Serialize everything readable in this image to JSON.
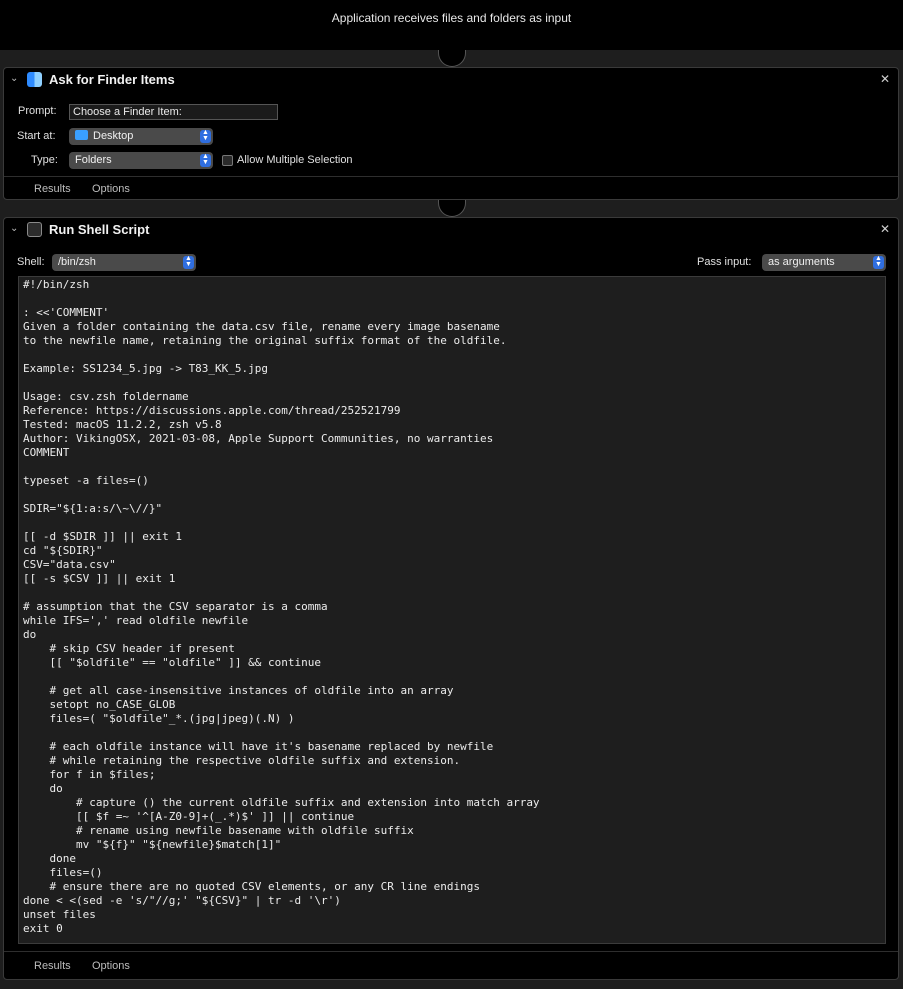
{
  "workflow": {
    "header_text": "Application receives files and folders as input"
  },
  "ask_finder": {
    "title": "Ask for Finder Items",
    "prompt_label": "Prompt:",
    "prompt_value": "Choose a Finder Item:",
    "start_label": "Start at:",
    "start_value": "Desktop",
    "type_label": "Type:",
    "type_value": "Folders",
    "allow_multiple_label": "Allow Multiple Selection",
    "allow_multiple_checked": false,
    "tabs": [
      "Results",
      "Options"
    ]
  },
  "shell_action": {
    "title": "Run Shell Script",
    "shell_label": "Shell:",
    "shell_value": "/bin/zsh",
    "pass_input_label": "Pass input:",
    "pass_input_value": "as arguments",
    "script": "#!/bin/zsh\n\n: <<'COMMENT'\nGiven a folder containing the data.csv file, rename every image basename\nto the newfile name, retaining the original suffix format of the oldfile.\n\nExample: SS1234_5.jpg -> T83_KK_5.jpg\n\nUsage: csv.zsh foldername\nReference: https://discussions.apple.com/thread/252521799\nTested: macOS 11.2.2, zsh v5.8\nAuthor: VikingOSX, 2021-03-08, Apple Support Communities, no warranties\nCOMMENT\n\ntypeset -a files=()\n\nSDIR=\"${1:a:s/\\~\\//}\"\n\n[[ -d $SDIR ]] || exit 1\ncd \"${SDIR}\"\nCSV=\"data.csv\"\n[[ -s $CSV ]] || exit 1\n\n# assumption that the CSV separator is a comma\nwhile IFS=',' read oldfile newfile\ndo\n    # skip CSV header if present\n    [[ \"$oldfile\" == \"oldfile\" ]] && continue\n\n    # get all case-insensitive instances of oldfile into an array\n    setopt no_CASE_GLOB\n    files=( \"$oldfile\"_*.(jpg|jpeg)(.N) )\n\n    # each oldfile instance will have it's basename replaced by newfile\n    # while retaining the respective oldfile suffix and extension.\n    for f in $files;\n    do\n        # capture () the current oldfile suffix and extension into match array\n        [[ $f =~ '^[A-Z0-9]+(_.*)$' ]] || continue\n        # rename using newfile basename with oldfile suffix\n        mv \"${f}\" \"${newfile}$match[1]\"\n    done\n    files=()\n    # ensure there are no quoted CSV elements, or any CR line endings\ndone < <(sed -e 's/\"//g;' \"${CSV}\" | tr -d '\\r')\nunset files\nexit 0",
    "tabs": [
      "Results",
      "Options"
    ]
  },
  "icons": {
    "collapse": "chevron-down-icon",
    "close": "close-icon",
    "finder": "finder-icon",
    "terminal": "terminal-icon",
    "folder": "folder-icon",
    "popup": "popup-stepper-icon"
  }
}
